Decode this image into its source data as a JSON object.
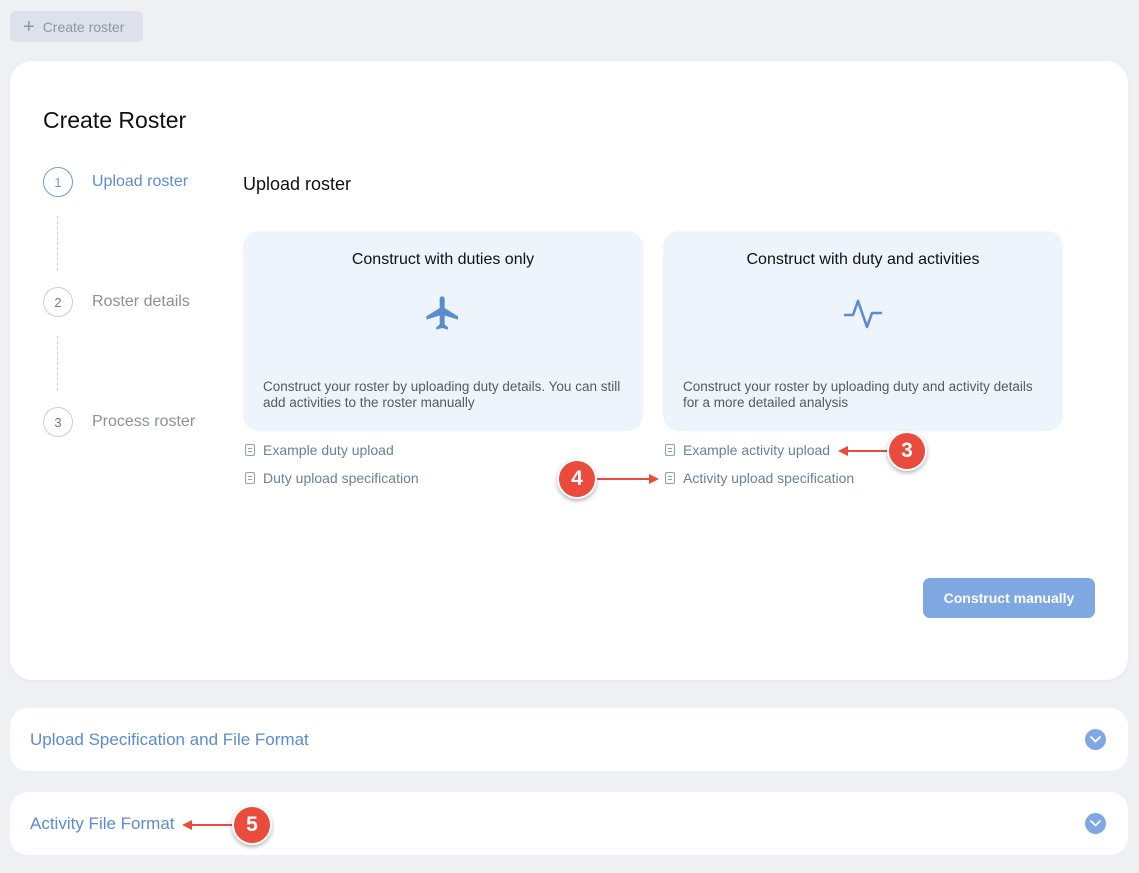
{
  "topbar": {
    "create_roster_label": "Create roster"
  },
  "card": {
    "title": "Create Roster",
    "steps": [
      {
        "number": "1",
        "label": "Upload roster"
      },
      {
        "number": "2",
        "label": "Roster details"
      },
      {
        "number": "3",
        "label": "Process roster"
      }
    ],
    "section_title": "Upload roster",
    "options": [
      {
        "title": "Construct with duties only",
        "icon": "airplane-icon",
        "description": "Construct your roster by uploading duty details. You can still add activities to the roster manually",
        "links": [
          "Example duty upload",
          "Duty upload specification"
        ]
      },
      {
        "title": "Construct with duty and activities",
        "icon": "activity-pulse-icon",
        "description": "Construct your roster by uploading duty and activity details for a more detailed analysis",
        "links": [
          "Example activity upload",
          "Activity upload specification"
        ]
      }
    ],
    "construct_manually_label": "Construct manually"
  },
  "accordions": [
    {
      "title": "Upload Specification and File Format"
    },
    {
      "title": "Activity File Format"
    }
  ],
  "annotations": {
    "badge_3": "3",
    "badge_4": "4",
    "badge_5": "5"
  },
  "colors": {
    "accent": "#5b8ccf",
    "button": "#7fa8e3",
    "annotation_red": "#e94b3c",
    "option_bg": "#eef4fb",
    "page_bg": "#eef0f4"
  }
}
